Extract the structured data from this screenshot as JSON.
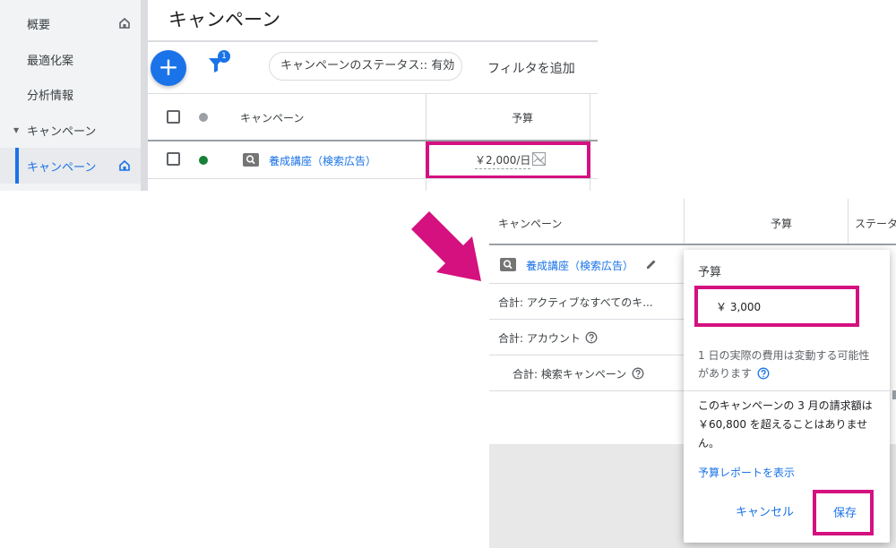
{
  "sidebar": {
    "items": [
      {
        "label": "概要"
      },
      {
        "label": "最適化案"
      },
      {
        "label": "分析情報"
      },
      {
        "label": "キャンペーン"
      },
      {
        "label": "キャンペーン"
      }
    ]
  },
  "header": {
    "title": "キャンペーン"
  },
  "toolbar": {
    "add_symbol": "+",
    "filter_count": "1",
    "status_chip": "キャンペーンのステータス:: 有効",
    "add_filter": "フィルタを追加"
  },
  "table_top": {
    "col_campaign": "キャンペーン",
    "col_budget": "予算",
    "row": {
      "campaign": "養成講座（検索広告）",
      "budget": "￥2,000/日",
      "status_color": "#188038"
    }
  },
  "table_bottom": {
    "col_campaign": "キャンペーン",
    "col_budget": "予算",
    "col_status": "ステータ",
    "rows": [
      {
        "label": "養成講座（検索広告）"
      },
      {
        "label": "合計: アクティブなすべてのキ..."
      },
      {
        "label": "合計: アカウント"
      },
      {
        "label": "合計: 検索キャンペーン"
      }
    ]
  },
  "popup": {
    "title": "予算",
    "input_value": "￥ 3,000",
    "note": "1 日の実際の費用は変動する可能性があります",
    "info": "このキャンペーンの 3 月の請求額は ￥60,800 を超えることはありません。",
    "link": "予算レポートを表示",
    "cancel": "キャンセル",
    "save": "保存"
  },
  "colors": {
    "accent": "#1a73e8",
    "highlight": "#d4117f",
    "arrow": "#d4117f"
  }
}
